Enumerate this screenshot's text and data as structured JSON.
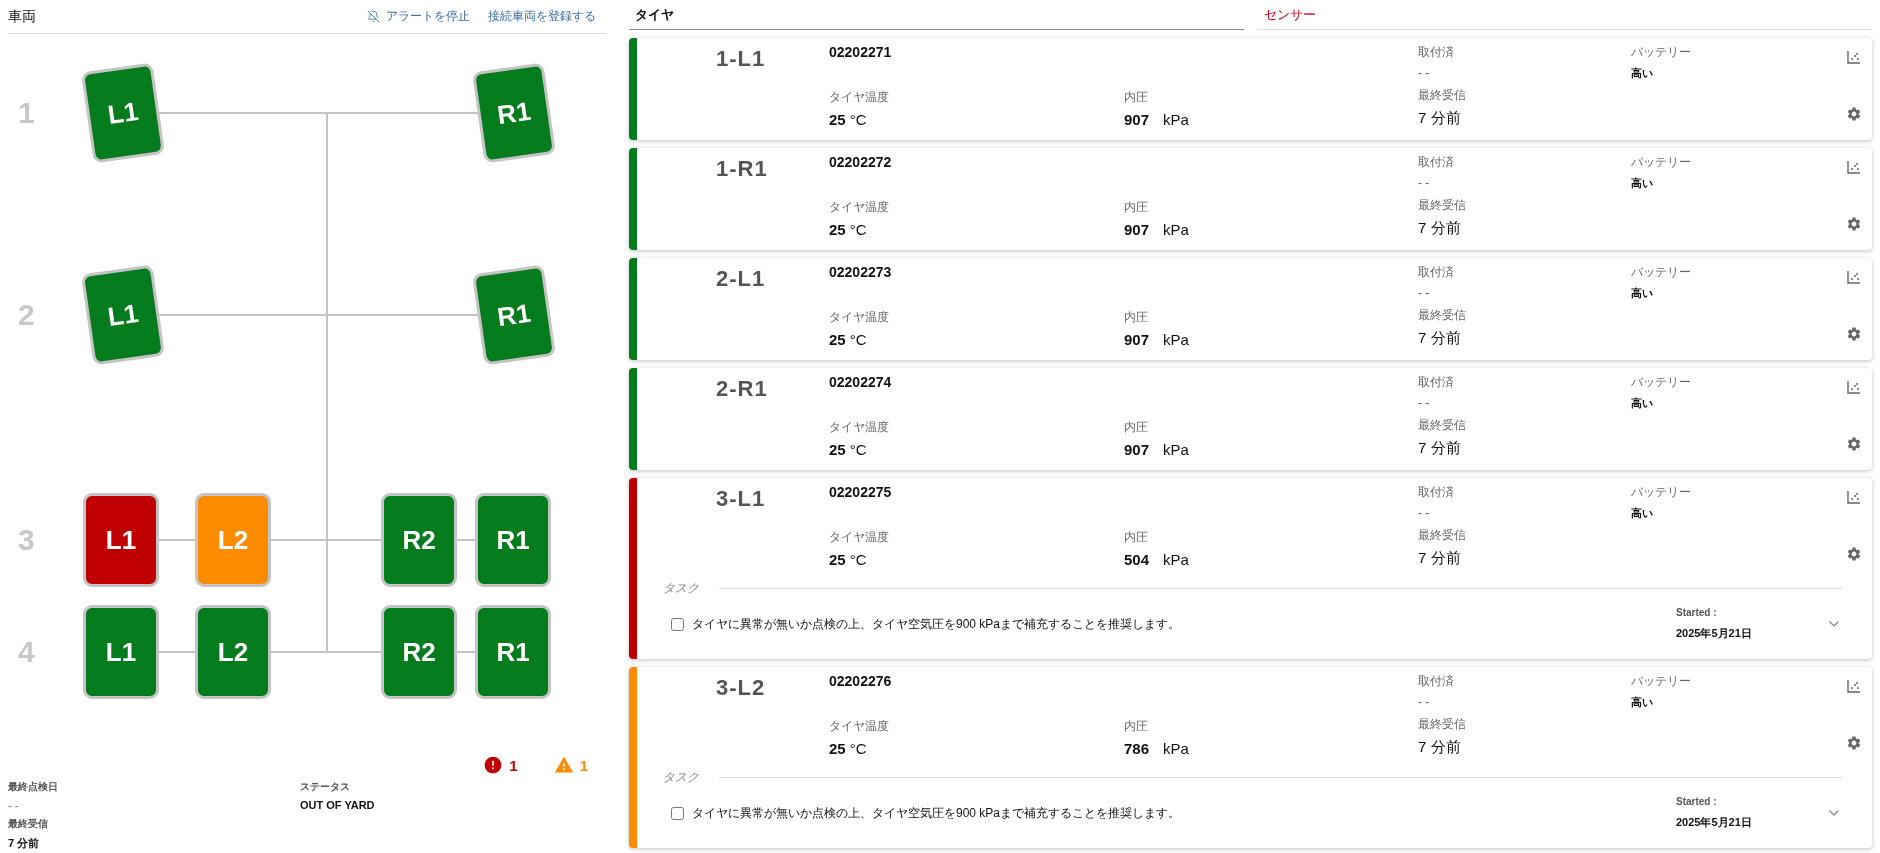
{
  "vehicle": {
    "title": "車両",
    "actions": [
      {
        "kind": "mute",
        "label": "アラートを停止"
      },
      {
        "kind": "link",
        "label": "接続車両を登録する"
      }
    ],
    "axles": [
      {
        "number": "1",
        "kind": "steer",
        "left": [
          {
            "label": "L1",
            "color": "#047b1c"
          }
        ],
        "right": [
          {
            "label": "R1",
            "color": "#047b1c"
          }
        ]
      },
      {
        "number": "2",
        "kind": "steer",
        "left": [
          {
            "label": "L1",
            "color": "#047b1c"
          }
        ],
        "right": [
          {
            "label": "R1",
            "color": "#047b1c"
          }
        ]
      },
      {
        "number": "3",
        "kind": "dual",
        "left": [
          {
            "label": "L1",
            "color": "#c00000"
          },
          {
            "label": "L2",
            "color": "#ff8c00"
          }
        ],
        "right": [
          {
            "label": "R2",
            "color": "#047b1c"
          },
          {
            "label": "R1",
            "color": "#047b1c"
          }
        ]
      },
      {
        "number": "4",
        "kind": "dual",
        "left": [
          {
            "label": "L1",
            "color": "#047b1c"
          },
          {
            "label": "L2",
            "color": "#047b1c"
          }
        ],
        "right": [
          {
            "label": "R2",
            "color": "#047b1c"
          },
          {
            "label": "R1",
            "color": "#047b1c"
          }
        ]
      }
    ],
    "alerts": [
      {
        "kind": "error",
        "count": "1"
      },
      {
        "kind": "warning",
        "count": "1"
      }
    ],
    "info": [
      {
        "label": "最終点検日",
        "value": "- -",
        "kind": "muted"
      },
      {
        "label": "ステータス",
        "value": "OUT OF YARD",
        "kind": "strong"
      },
      {
        "label": "最終受信",
        "value": "7 分前",
        "kind": "strong"
      }
    ]
  },
  "tabs": [
    {
      "label": "タイヤ",
      "selected": true
    },
    {
      "label": "センサー",
      "selected": false
    }
  ],
  "tires": [
    {
      "position": "1-L1",
      "color": "#047b1c",
      "sensor_id": "02202271",
      "temperature": {
        "label": "タイヤ温度",
        "value": "25",
        "unit": "°C"
      },
      "pressure": {
        "label": "内圧",
        "value": "907",
        "unit": "kPa"
      },
      "installed": {
        "label": "取付済",
        "value": "- -"
      },
      "last_received": {
        "label": "最終受信",
        "value": "7 分前"
      },
      "battery": {
        "label": "バッテリー",
        "value": "高い"
      }
    },
    {
      "position": "1-R1",
      "color": "#047b1c",
      "sensor_id": "02202272",
      "temperature": {
        "label": "タイヤ温度",
        "value": "25",
        "unit": "°C"
      },
      "pressure": {
        "label": "内圧",
        "value": "907",
        "unit": "kPa"
      },
      "installed": {
        "label": "取付済",
        "value": "- -"
      },
      "last_received": {
        "label": "最終受信",
        "value": "7 分前"
      },
      "battery": {
        "label": "バッテリー",
        "value": "高い"
      }
    },
    {
      "position": "2-L1",
      "color": "#047b1c",
      "sensor_id": "02202273",
      "temperature": {
        "label": "タイヤ温度",
        "value": "25",
        "unit": "°C"
      },
      "pressure": {
        "label": "内圧",
        "value": "907",
        "unit": "kPa"
      },
      "installed": {
        "label": "取付済",
        "value": "- -"
      },
      "last_received": {
        "label": "最終受信",
        "value": "7 分前"
      },
      "battery": {
        "label": "バッテリー",
        "value": "高い"
      }
    },
    {
      "position": "2-R1",
      "color": "#047b1c",
      "sensor_id": "02202274",
      "temperature": {
        "label": "タイヤ温度",
        "value": "25",
        "unit": "°C"
      },
      "pressure": {
        "label": "内圧",
        "value": "907",
        "unit": "kPa"
      },
      "installed": {
        "label": "取付済",
        "value": "- -"
      },
      "last_received": {
        "label": "最終受信",
        "value": "7 分前"
      },
      "battery": {
        "label": "バッテリー",
        "value": "高い"
      }
    },
    {
      "position": "3-L1",
      "color": "#c00000",
      "sensor_id": "02202275",
      "temperature": {
        "label": "タイヤ温度",
        "value": "25",
        "unit": "°C"
      },
      "pressure": {
        "label": "内圧",
        "value": "504",
        "unit": "kPa"
      },
      "installed": {
        "label": "取付済",
        "value": "- -"
      },
      "last_received": {
        "label": "最終受信",
        "value": "7 分前"
      },
      "battery": {
        "label": "バッテリー",
        "value": "高い"
      },
      "task": {
        "heading": "タスク",
        "text": "タイヤに異常が無いか点検の上、タイヤ空気圧を900 kPaまで補充することを推奨します。",
        "checked": false,
        "started_label": "Started :",
        "started_date": "2025年5月21日"
      }
    },
    {
      "position": "3-L2",
      "color": "#ff8c00",
      "sensor_id": "02202276",
      "temperature": {
        "label": "タイヤ温度",
        "value": "25",
        "unit": "°C"
      },
      "pressure": {
        "label": "内圧",
        "value": "786",
        "unit": "kPa"
      },
      "installed": {
        "label": "取付済",
        "value": "- -"
      },
      "last_received": {
        "label": "最終受信",
        "value": "7 分前"
      },
      "battery": {
        "label": "バッテリー",
        "value": "高い"
      },
      "task": {
        "heading": "タスク",
        "text": "タイヤに異常が無いか点検の上、タイヤ空気圧を900 kPaまで補充することを推奨します。",
        "checked": false,
        "started_label": "Started :",
        "started_date": "2025年5月21日"
      }
    }
  ]
}
